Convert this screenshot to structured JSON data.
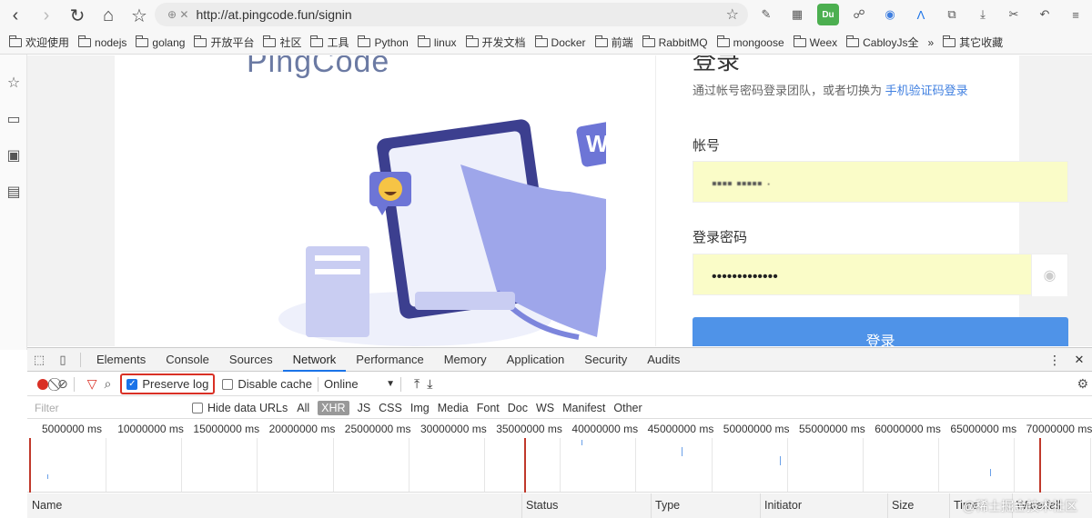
{
  "browser": {
    "url": "http://at.pingcode.fun/signin",
    "bookmarks": [
      "欢迎使用",
      "nodejs",
      "golang",
      "开放平台",
      "社区",
      "工具",
      "Python",
      "linux",
      "开发文档",
      "Docker",
      "前端",
      "RabbitMQ",
      "mongoose",
      "Weex",
      "CabloyJs全",
      "»",
      "其它收藏"
    ]
  },
  "login": {
    "logo_text": "PingCode",
    "title": "登录",
    "subtitle": "通过帐号密码登录团队，或者切换为",
    "subtitle_link": "手机验证码登录",
    "account_label": "帐号",
    "account_value": "▪▪▪▪ ▪▪▪▪▪ ·",
    "password_label": "登录密码",
    "password_value": "•••••••••••••",
    "submit_label": "登录"
  },
  "devtools": {
    "tabs": [
      "Elements",
      "Console",
      "Sources",
      "Network",
      "Performance",
      "Memory",
      "Application",
      "Security",
      "Audits"
    ],
    "active_tab": "Network",
    "preserve_log": "Preserve log",
    "disable_cache": "Disable cache",
    "throttle": "Online",
    "filter_placeholder": "Filter",
    "hide_data_urls": "Hide data URLs",
    "types": [
      "All",
      "XHR",
      "JS",
      "CSS",
      "Img",
      "Media",
      "Font",
      "Doc",
      "WS",
      "Manifest",
      "Other"
    ],
    "selected_type": "XHR",
    "timeline_ticks": [
      "5000000 ms",
      "10000000 ms",
      "15000000 ms",
      "20000000 ms",
      "25000000 ms",
      "30000000 ms",
      "35000000 ms",
      "40000000 ms",
      "45000000 ms",
      "50000000 ms",
      "55000000 ms",
      "60000000 ms",
      "65000000 ms",
      "70000000 ms"
    ],
    "columns": [
      "Name",
      "Status",
      "Type",
      "Initiator",
      "Size",
      "Time",
      "Waterfall"
    ]
  },
  "watermark": "@稀土掘金技术社区"
}
